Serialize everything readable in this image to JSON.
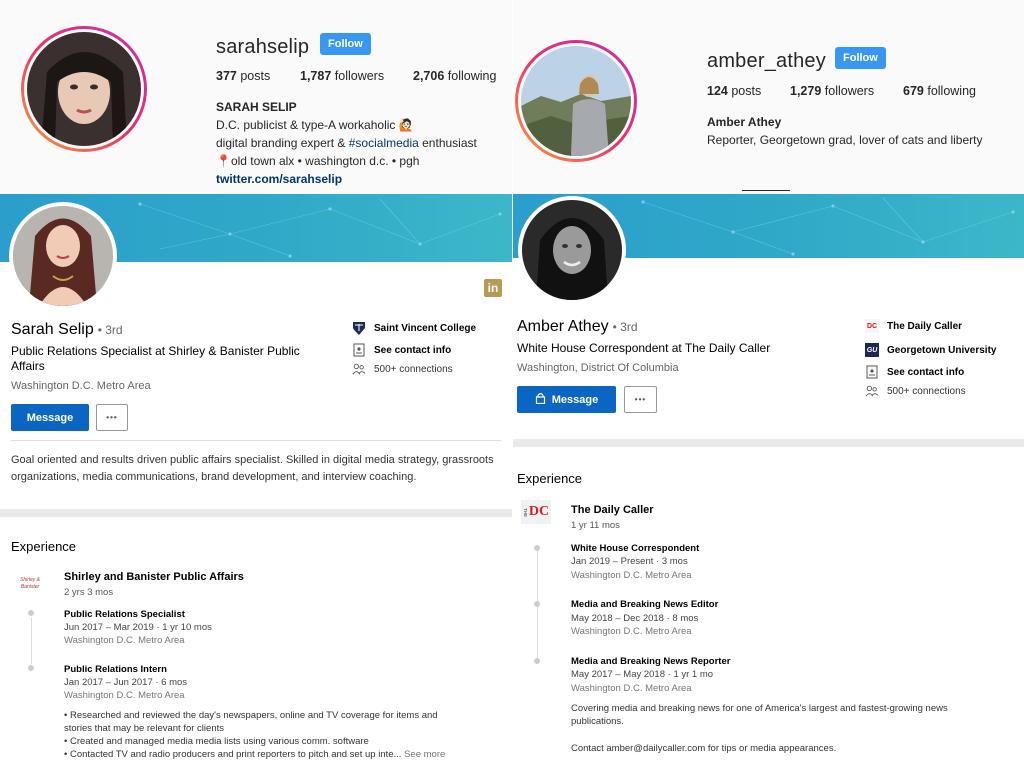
{
  "sarah_ig": {
    "username": "sarahselip",
    "follow_label": "Follow",
    "posts_count": "377",
    "posts_label": "posts",
    "followers_count": "1,787",
    "followers_label": "followers",
    "following_count": "2,706",
    "following_label": "following",
    "full_name": "SARAH SELIP",
    "bio_line1": "D.C. publicist & type-A workaholic 🙋🏻",
    "bio_line2_pre": "digital branding expert & ",
    "bio_hashtag": "#socialmedia",
    "bio_line2_post": " enthusiast",
    "bio_line3": "📍old town alx • washington d.c. • pgh",
    "link": "twitter.com/sarahselip"
  },
  "amber_ig": {
    "username": "amber_athey",
    "follow_label": "Follow",
    "posts_count": "124",
    "posts_label": "posts",
    "followers_count": "1,279",
    "followers_label": "followers",
    "following_count": "679",
    "following_label": "following",
    "full_name": "Amber Athey",
    "bio": "Reporter, Georgetown grad, lover of cats and liberty"
  },
  "sarah_li": {
    "badge": "in",
    "name": "Sarah Selip",
    "degree": "• 3rd",
    "headline": "Public Relations Specialist at Shirley & Banister Public Affairs",
    "location": "Washington D.C. Metro Area",
    "message_label": "Message",
    "more_label": "•••",
    "school": "Saint Vincent College",
    "contact": "See contact info",
    "connections": "500+ connections",
    "summary": "Goal oriented and results driven public affairs specialist. Skilled in digital media strategy, grassroots organizations, media communications, brand development, and interview coaching.",
    "experience_heading": "Experience",
    "company": "Shirley and Banister Public Affairs",
    "company_duration": "2 yrs 3 mos",
    "company_logo_text": "Shirley & Banister",
    "roles": [
      {
        "title": "Public Relations Specialist",
        "dates": "Jun 2017 – Mar 2019 · 1 yr 10 mos",
        "location": "Washington D.C. Metro Area"
      },
      {
        "title": "Public Relations Intern",
        "dates": "Jan 2017 – Jun 2017 · 6 mos",
        "location": "Washington D.C. Metro Area"
      }
    ],
    "desc1": "• Researched and reviewed the day's newspapers, online and TV coverage for items and",
    "desc2": "stories that may be relevant for clients",
    "desc3": "• Created and managed media media lists using various comm. software",
    "desc4": "• Contacted TV and radio producers and print reporters to pitch and set up inte...",
    "see_more": "See more"
  },
  "amber_li": {
    "name": "Amber Athey",
    "degree": "• 3rd",
    "headline": "White House Correspondent at The Daily Caller",
    "location": "Washington, District Of Columbia",
    "message_label": "Message",
    "more_label": "•••",
    "employer": "The Daily Caller",
    "school": "Georgetown University",
    "contact": "See contact info",
    "connections": "500+ connections",
    "experience_heading": "Experience",
    "company": "The Daily Caller",
    "company_duration": "1 yr 11 mos",
    "company_logo_text": "DC",
    "company_logo_small": "THE",
    "school_logo_text": "GU",
    "roles": [
      {
        "title": "White House Correspondent",
        "dates": "Jan 2019 – Present · 3 mos",
        "location": "Washington D.C. Metro Area"
      },
      {
        "title": "Media and Breaking News Editor",
        "dates": "May 2018 – Dec 2018 · 8 mos",
        "location": "Washington D.C. Metro Area"
      },
      {
        "title": "Media and Breaking News Reporter",
        "dates": "May 2017 – May 2018 · 1 yr 1 mo",
        "location": "Washington D.C. Metro Area"
      }
    ],
    "desc1": "Covering media and breaking news for one of America's largest and fastest-growing news",
    "desc2": "publications.",
    "desc3": "Contact amber@dailycaller.com for tips or media appearances."
  },
  "colors": {
    "ig_follow": "#3897f0",
    "li_blue": "#0a66c2",
    "banner": "#2fa8c8",
    "li_gold": "#b79a53"
  }
}
